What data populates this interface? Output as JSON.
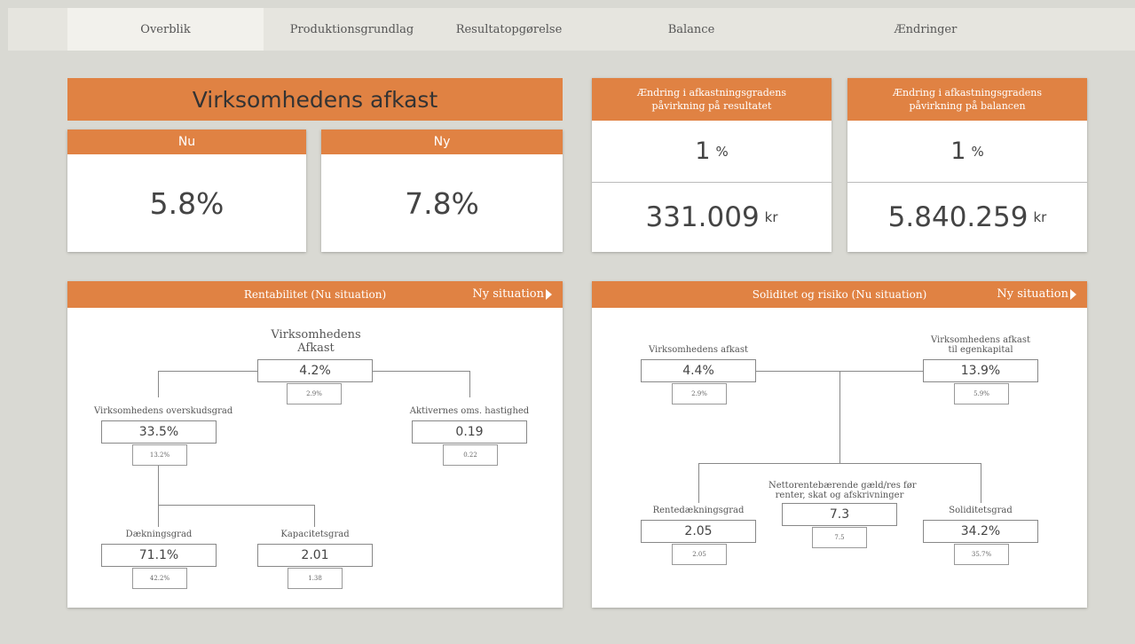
{
  "tabs": [
    "Overblik",
    "Produktionsgrundlag",
    "Resultatopgørelse",
    "Balance",
    "Ændringer"
  ],
  "return_block": {
    "title": "Virksomhedens afkast",
    "nu_label": "Nu",
    "nu_value": "5.8%",
    "ny_label": "Ny",
    "ny_value": "7.8%"
  },
  "change_result": {
    "title": "Ændring i afkastningsgradens påvirkning på resultatet",
    "pct": "1",
    "pct_unit": "%",
    "amount": "331.009",
    "amount_unit": "kr"
  },
  "change_balance": {
    "title": "Ændring i afkastningsgradens påvirkning på balancen",
    "pct": "1",
    "pct_unit": "%",
    "amount": "5.840.259",
    "amount_unit": "kr"
  },
  "rentabilitet": {
    "title": "Rentabilitet (Nu situation)",
    "link": "Ny situation",
    "root": {
      "label1": "Virksomhedens",
      "label2": "Afkast",
      "value": "4.2%",
      "sub": "2.9%"
    },
    "overskud": {
      "label": "Virksomhedens overskudsgrad",
      "value": "33.5%",
      "sub": "13.2%"
    },
    "aktiver": {
      "label": "Aktivernes oms. hastighed",
      "value": "0.19",
      "sub": "0.22"
    },
    "daekning": {
      "label": "Dækningsgrad",
      "value": "71.1%",
      "sub": "42.2%"
    },
    "kapacitet": {
      "label": "Kapacitetsgrad",
      "value": "2.01",
      "sub": "1.38"
    }
  },
  "soliditet": {
    "title": "Soliditet og risiko (Nu situation)",
    "link": "Ny situation",
    "afkast": {
      "label": "Virksomhedens afkast",
      "value": "4.4%",
      "sub": "2.9%"
    },
    "egenkapital": {
      "label1": "Virksomhedens afkast",
      "label2": "til egenkapital",
      "value": "13.9%",
      "sub": "5.9%"
    },
    "rentedaekning": {
      "label": "Rentedækningsgrad",
      "value": "2.05",
      "sub": "2.05"
    },
    "netto": {
      "label1": "Nettorentebærende gæld/res før",
      "label2": "renter, skat og afskrivninger",
      "value": "7.3",
      "sub": "7.5"
    },
    "soliditetsgrad": {
      "label": "Soliditetsgrad",
      "value": "34.2%",
      "sub": "35.7%"
    }
  },
  "colors": {
    "accent": "#e08243",
    "background": "#d9d9d3"
  }
}
